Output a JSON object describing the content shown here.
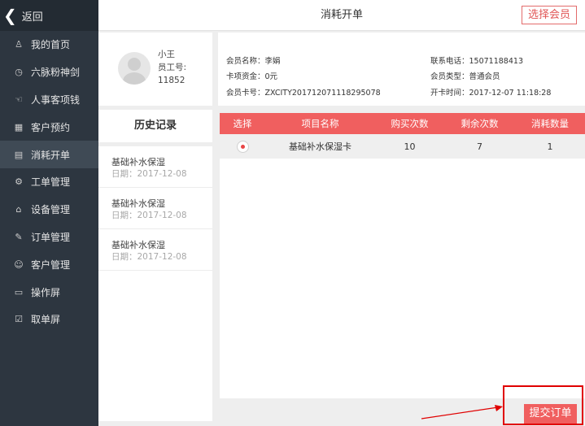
{
  "sidebar": {
    "back_label": "返回",
    "items": [
      {
        "label": "我的首页",
        "icon": "person-icon",
        "glyph": "♙"
      },
      {
        "label": "六脉粉神剑",
        "icon": "timer-icon",
        "glyph": "◷"
      },
      {
        "label": "人事客项钱",
        "icon": "hand-icon",
        "glyph": "☜"
      },
      {
        "label": "客户预约",
        "icon": "calendar-icon",
        "glyph": "▦"
      },
      {
        "label": "消耗开单",
        "icon": "receipt-icon",
        "glyph": "▤"
      },
      {
        "label": "工单管理",
        "icon": "gear-icon",
        "glyph": "⚙"
      },
      {
        "label": "设备管理",
        "icon": "home-icon",
        "glyph": "⌂"
      },
      {
        "label": "订单管理",
        "icon": "edit-icon",
        "glyph": "✎"
      },
      {
        "label": "客户管理",
        "icon": "users-icon",
        "glyph": "☺"
      },
      {
        "label": "操作屏",
        "icon": "monitor-icon",
        "glyph": "▭"
      },
      {
        "label": "取单屏",
        "icon": "check-box-icon",
        "glyph": "☑"
      }
    ],
    "active_index": 4
  },
  "header": {
    "title": "消耗开单",
    "select_member_label": "选择会员"
  },
  "profile": {
    "name": "小王",
    "staff_id_label": "员工号:",
    "staff_id": "11852"
  },
  "history": {
    "title": "历史记录",
    "items": [
      {
        "name": "基础补水保湿",
        "date": "日期：2017-12-08"
      },
      {
        "name": "基础补水保湿",
        "date": "日期：2017-12-08"
      },
      {
        "name": "基础补水保湿",
        "date": "日期：2017-12-08"
      }
    ]
  },
  "member": {
    "name_label": "会员名称：李娟",
    "funds_label": "卡项资金：0元",
    "card_label": "会员卡号：ZXCITY201712071118295078",
    "phone_label": "联系电话：15071188413",
    "type_label": "会员类型：普通会员",
    "open_label": "开卡时间：2017-12-07 11:18:28"
  },
  "table": {
    "headers": [
      "选择",
      "项目名称",
      "购买次数",
      "剩余次数",
      "消耗数量"
    ],
    "rows": [
      {
        "selected": true,
        "name": "基础补水保湿卡",
        "purchased": "10",
        "remaining": "7",
        "consumed": "1"
      }
    ]
  },
  "footer": {
    "submit_label": "提交订单"
  },
  "colors": {
    "accent": "#f05f5f",
    "sidebar_bg": "#2d3640",
    "annotation": "#e00000"
  }
}
